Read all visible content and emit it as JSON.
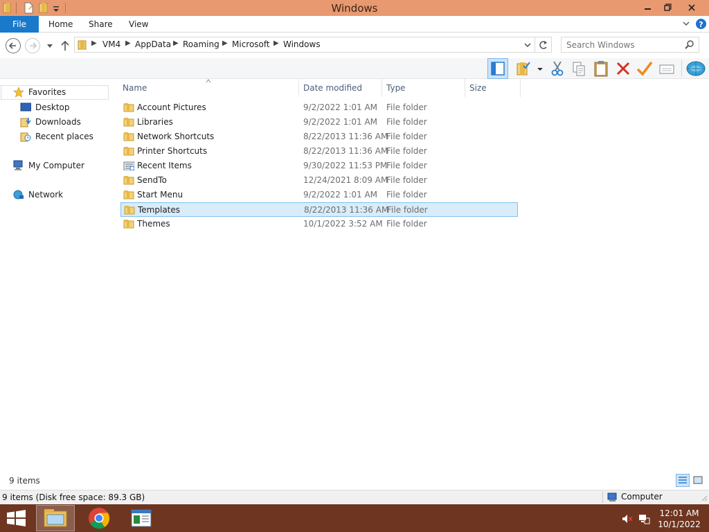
{
  "window": {
    "title": "Windows"
  },
  "ribbon": {
    "tabs": [
      "File",
      "Home",
      "Share",
      "View"
    ]
  },
  "address": {
    "crumbs": [
      "VM4",
      "AppData",
      "Roaming",
      "Microsoft",
      "Windows"
    ],
    "search_placeholder": "Search Windows"
  },
  "nav": {
    "favorites": "Favorites",
    "fav_items": [
      "Desktop",
      "Downloads",
      "Recent places"
    ],
    "computer": "My Computer",
    "network": "Network"
  },
  "columns": {
    "name": "Name",
    "date": "Date modified",
    "type": "Type",
    "size": "Size"
  },
  "files": [
    {
      "name": "Account Pictures",
      "date": "9/2/2022 1:01 AM",
      "type": "File folder",
      "icon": "folder-icon"
    },
    {
      "name": "Libraries",
      "date": "9/2/2022 1:01 AM",
      "type": "File folder",
      "icon": "folder-icon"
    },
    {
      "name": "Network Shortcuts",
      "date": "8/22/2013 11:36 AM",
      "type": "File folder",
      "icon": "folder-icon"
    },
    {
      "name": "Printer Shortcuts",
      "date": "8/22/2013 11:36 AM",
      "type": "File folder",
      "icon": "folder-icon"
    },
    {
      "name": "Recent Items",
      "date": "9/30/2022 11:53 PM",
      "type": "File folder",
      "icon": "recent-items-icon"
    },
    {
      "name": "SendTo",
      "date": "12/24/2021 8:09 AM",
      "type": "File folder",
      "icon": "folder-icon"
    },
    {
      "name": "Start Menu",
      "date": "9/2/2022 1:01 AM",
      "type": "File folder",
      "icon": "folder-icon"
    },
    {
      "name": "Templates",
      "date": "8/22/2013 11:36 AM",
      "type": "File folder",
      "icon": "folder-icon",
      "selected": true
    },
    {
      "name": "Themes",
      "date": "10/1/2022 3:52 AM",
      "type": "File folder",
      "icon": "folder-icon"
    }
  ],
  "status": {
    "items_count": "9 items",
    "disk_info": "9 items (Disk free space: 89.3 GB)",
    "location": "Computer"
  },
  "taskbar": {
    "time": "12:01 AM",
    "date": "10/1/2022",
    "apps": [
      "file-explorer-icon",
      "chrome-icon",
      "app-window-icon"
    ]
  },
  "colors": {
    "titlebar": "#e8996f",
    "file_tab": "#1979ca",
    "taskbar": "#6e3520",
    "selection": "#d9ecfa",
    "folder": "#e8c262"
  }
}
